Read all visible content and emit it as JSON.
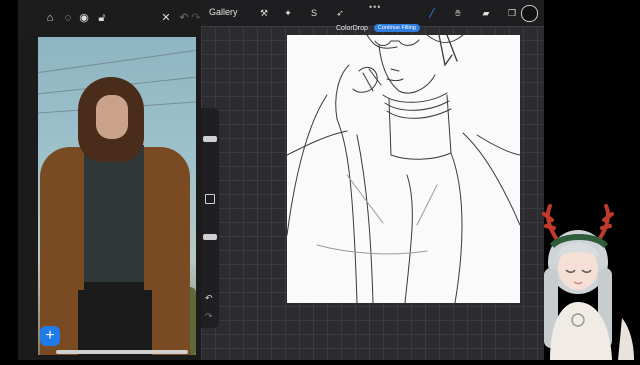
{
  "photos": {
    "toolbar_icons": [
      "home-icon",
      "dotted-circle-icon",
      "eye-icon",
      "lock-icon",
      "close-icon",
      "undo-icon",
      "redo-icon"
    ],
    "add_button_label": "+"
  },
  "procreate": {
    "gallery_label": "Gallery",
    "tools": [
      "wrench-icon",
      "magic-wand-icon",
      "selection-icon",
      "transform-icon",
      "brush-icon",
      "smudge-icon",
      "eraser-icon",
      "layers-icon"
    ],
    "menu_dots": "•••",
    "toast": {
      "label": "ColorDrop",
      "button": "Continue Filling"
    },
    "colors": {
      "accent": "#2f7de1",
      "current_color": "#111111"
    }
  }
}
